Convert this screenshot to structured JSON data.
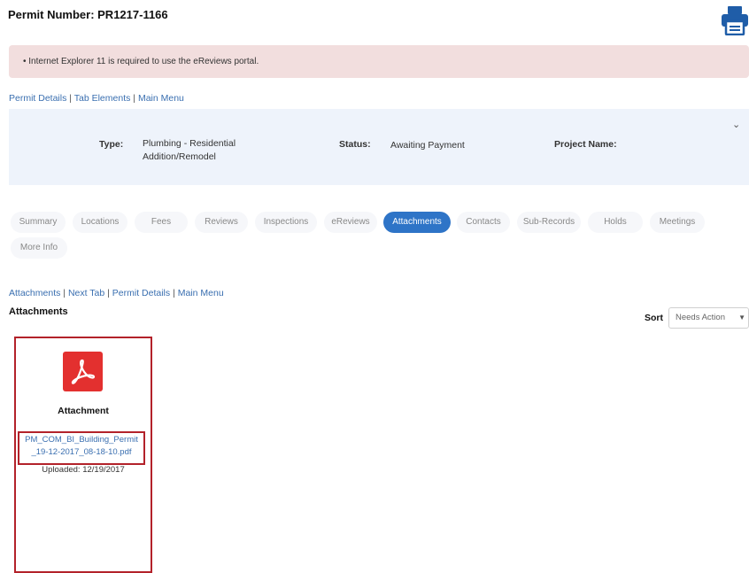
{
  "header": {
    "permit_title": "Permit Number: PR1217-1166"
  },
  "alert": {
    "text": "• Internet Explorer 11 is required to use the eReviews portal."
  },
  "breadcrumb_top": {
    "permit_details": "Permit Details",
    "tab_elements": "Tab Elements",
    "main_menu": "Main Menu"
  },
  "details": {
    "type_label": "Type:",
    "type_value": "Plumbing - Residential Addition/Remodel",
    "status_label": "Status:",
    "status_value": "Awaiting Payment",
    "project_name_label": "Project Name:",
    "project_name_value": ""
  },
  "tabs": [
    {
      "label": "Summary"
    },
    {
      "label": "Locations"
    },
    {
      "label": "Fees"
    },
    {
      "label": "Reviews"
    },
    {
      "label": "Inspections"
    },
    {
      "label": "eReviews"
    },
    {
      "label": "Attachments",
      "active": true
    },
    {
      "label": "Contacts"
    },
    {
      "label": "Sub-Records"
    },
    {
      "label": "Holds"
    },
    {
      "label": "Meetings"
    },
    {
      "label": "More Info"
    }
  ],
  "breadcrumb_bottom": {
    "attachments": "Attachments",
    "next_tab": "Next Tab",
    "permit_details": "Permit Details",
    "main_menu": "Main Menu"
  },
  "attachments": {
    "heading": "Attachments",
    "sort_label": "Sort",
    "sort_value": "Needs Action",
    "items": [
      {
        "icon": "pdf-icon",
        "title": "Attachment",
        "file_name": "PM_COM_BI_Building_Permit\n_19-12-2017_08-18-10.pdf",
        "uploaded": "Uploaded: 12/19/2017"
      }
    ]
  },
  "colors": {
    "accent": "#2e74c7",
    "alert_bg": "#f2dede",
    "panel_bg": "#eef3fb",
    "highlight": "#b3222a",
    "pdf_red": "#e3302f"
  }
}
